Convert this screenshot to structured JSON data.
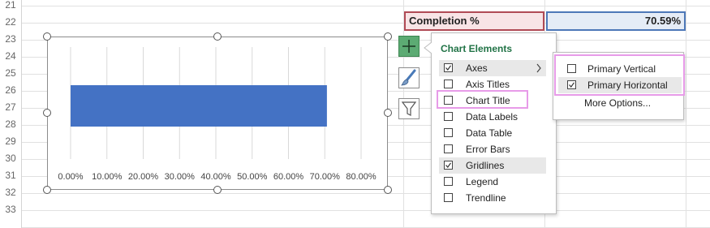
{
  "row_numbers": [
    "21",
    "22",
    "23",
    "24",
    "25",
    "26",
    "27",
    "28",
    "29",
    "30",
    "31",
    "32",
    "33"
  ],
  "cells": {
    "label": "Completion %",
    "value": "70.59%"
  },
  "chart_data": {
    "type": "bar",
    "orientation": "horizontal",
    "categories": [
      ""
    ],
    "values": [
      70.59
    ],
    "xlim": [
      0,
      80
    ],
    "x_ticks": [
      "0.00%",
      "10.00%",
      "20.00%",
      "30.00%",
      "40.00%",
      "50.00%",
      "60.00%",
      "70.00%",
      "80.00%"
    ],
    "grid": true,
    "bar_color": "#4472c4"
  },
  "side_buttons": {
    "chart_elements": "plus-icon",
    "chart_styles": "brush-icon",
    "chart_filters": "funnel-icon"
  },
  "chart_elements_menu": {
    "title": "Chart Elements",
    "items": [
      {
        "label": "Axes",
        "checked": true
      },
      {
        "label": "Axis Titles",
        "checked": false
      },
      {
        "label": "Chart Title",
        "checked": false
      },
      {
        "label": "Data Labels",
        "checked": false
      },
      {
        "label": "Data Table",
        "checked": false
      },
      {
        "label": "Error Bars",
        "checked": false
      },
      {
        "label": "Gridlines",
        "checked": true
      },
      {
        "label": "Legend",
        "checked": false
      },
      {
        "label": "Trendline",
        "checked": false
      }
    ],
    "submenu_arrow": "chevron-right-icon"
  },
  "axes_submenu": {
    "items": [
      {
        "label": "Primary Vertical",
        "checked": false
      },
      {
        "label": "Primary Horizontal",
        "checked": true
      }
    ],
    "more_options": "More Options..."
  },
  "colors": {
    "accent_green": "#217346",
    "highlight_pink": "#e79be8",
    "label_cell_fill": "#f8e4e6",
    "value_cell_fill": "#e5ecf6"
  }
}
